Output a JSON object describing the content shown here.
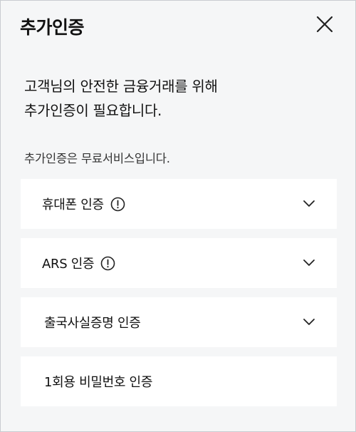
{
  "header": {
    "title": "추가인증"
  },
  "intro": {
    "line1": "고객님의 안전한 금융거래를 위해",
    "line2": "추가인증이 필요합니다."
  },
  "note": "추가인증은 무료서비스입니다.",
  "auth_options": [
    {
      "label": "휴대폰 인증",
      "has_info_icon": true,
      "expandable": true
    },
    {
      "label": "ARS 인증",
      "has_info_icon": true,
      "expandable": true
    },
    {
      "label": "출국사실증명 인증",
      "has_info_icon": false,
      "expandable": true
    },
    {
      "label": "1회용 비밀번호 인증",
      "has_info_icon": false,
      "expandable": false
    }
  ],
  "icons": {
    "close": "close-icon",
    "info": "info-circle-icon",
    "chevron": "chevron-down-icon"
  }
}
